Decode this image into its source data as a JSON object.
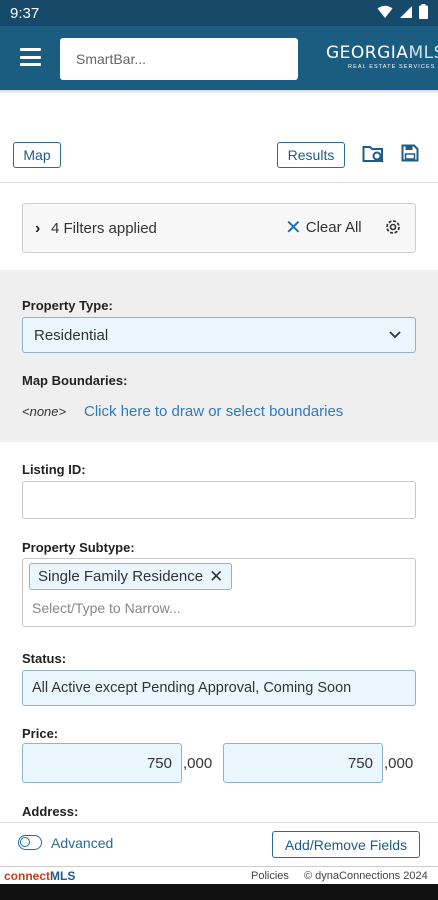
{
  "status_bar": {
    "time": "9:37"
  },
  "app_bar": {
    "smartbar_placeholder": "SmartBar...",
    "logo_main_a": "GEORGIA",
    "logo_main_b": "MLS",
    "logo_sub": "REAL ESTATE SERVICES"
  },
  "toolbar": {
    "map_label": "Map",
    "results_label": "Results"
  },
  "filters": {
    "summary": "4 Filters applied",
    "clear_all": "Clear All"
  },
  "property_type": {
    "label": "Property Type:",
    "value": "Residential"
  },
  "map_boundaries": {
    "label": "Map Boundaries:",
    "value": "<none>",
    "link": "Click here to draw or select boundaries"
  },
  "listing_id": {
    "label": "Listing ID:",
    "value": ""
  },
  "property_subtype": {
    "label": "Property Subtype:",
    "tag": "Single Family Residence",
    "placeholder": "Select/Type to Narrow..."
  },
  "status": {
    "label": "Status:",
    "value": "All Active except Pending Approval, Coming Soon"
  },
  "price": {
    "label": "Price:",
    "min": "750",
    "max": "750",
    "suffix": ",000"
  },
  "address": {
    "label": "Address:"
  },
  "bottom_bar": {
    "advanced_label": "Advanced",
    "add_remove_label": "Add/Remove Fields"
  },
  "footer": {
    "brand_a": "connect",
    "brand_b": "MLS",
    "policies": "Policies",
    "copyright": "© dynaConnections 2024"
  },
  "colors": {
    "header": "#1b5d80",
    "accent": "#2f7ab8",
    "field_bg": "#e9f6fd"
  }
}
